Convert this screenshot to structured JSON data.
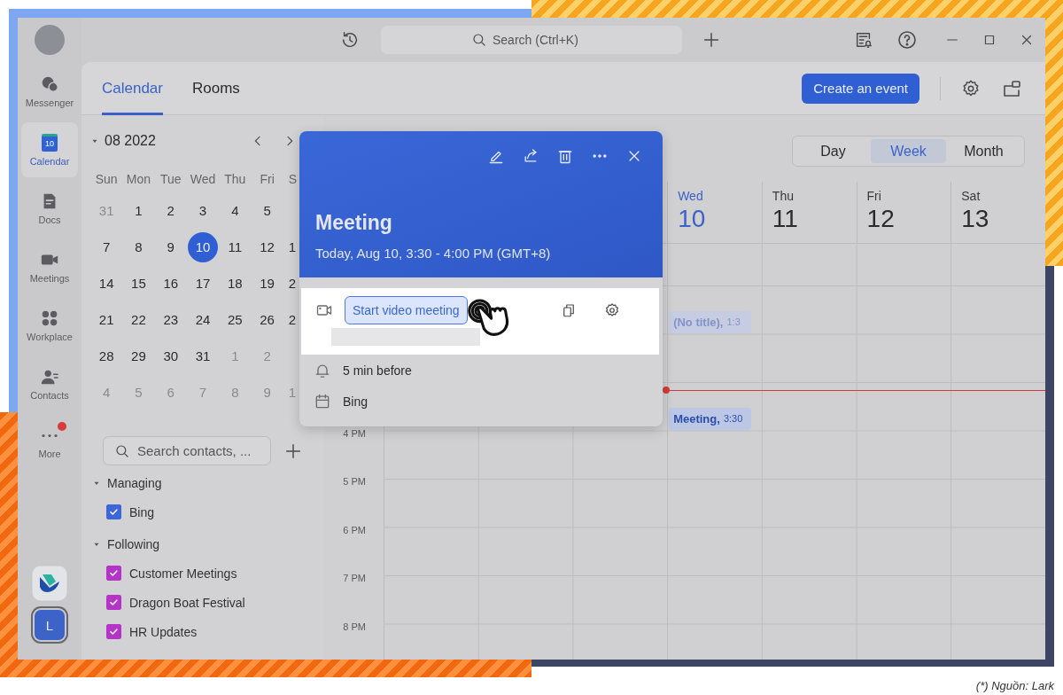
{
  "rail": {
    "items": [
      {
        "kind": "chat",
        "label": "Messenger",
        "selected": false
      },
      {
        "kind": "calendar",
        "label": "Calendar",
        "icon_text": "10",
        "selected": true
      },
      {
        "kind": "docs",
        "label": "Docs",
        "selected": false
      },
      {
        "kind": "video",
        "label": "Meetings",
        "selected": false
      },
      {
        "kind": "apps",
        "label": "Workplace",
        "selected": false
      },
      {
        "kind": "contacts",
        "label": "Contacts",
        "selected": false
      },
      {
        "kind": "more",
        "label": "More",
        "selected": false,
        "badge": true
      }
    ],
    "workspace_initial": "L"
  },
  "top_bar": {
    "search": {
      "placeholder": "Search (Ctrl+K)"
    }
  },
  "tabs": [
    {
      "label": "Calendar",
      "selected": true
    },
    {
      "label": "Rooms",
      "selected": false
    }
  ],
  "create_button": "Create an event",
  "mini_calendar": {
    "month": "08 2022",
    "weekdays": [
      "Sun",
      "Mon",
      "Tue",
      "Wed",
      "Thu",
      "Fri",
      "S"
    ],
    "weeks": [
      [
        {
          "day": "31",
          "muted": true,
          "selected": false
        },
        {
          "day": "1",
          "muted": false,
          "selected": false
        },
        {
          "day": "2",
          "muted": false,
          "selected": false
        },
        {
          "day": "3",
          "muted": false,
          "selected": false
        },
        {
          "day": "4",
          "muted": false,
          "selected": false
        },
        {
          "day": "5",
          "muted": false,
          "selected": false
        }
      ],
      [
        {
          "day": "7",
          "muted": false,
          "selected": false
        },
        {
          "day": "8",
          "muted": false,
          "selected": false
        },
        {
          "day": "9",
          "muted": false,
          "selected": false
        },
        {
          "day": "10",
          "muted": false,
          "selected": true
        },
        {
          "day": "11",
          "muted": false,
          "selected": false
        },
        {
          "day": "12",
          "muted": false,
          "selected": false
        },
        {
          "day": "1",
          "muted": false,
          "selected": false
        }
      ],
      [
        {
          "day": "14",
          "muted": false,
          "selected": false
        },
        {
          "day": "15",
          "muted": false,
          "selected": false
        },
        {
          "day": "16",
          "muted": false,
          "selected": false
        },
        {
          "day": "17",
          "muted": false,
          "selected": false
        },
        {
          "day": "18",
          "muted": false,
          "selected": false
        },
        {
          "day": "19",
          "muted": false,
          "selected": false
        },
        {
          "day": "2",
          "muted": false,
          "selected": false
        }
      ],
      [
        {
          "day": "21",
          "muted": false,
          "selected": false
        },
        {
          "day": "22",
          "muted": false,
          "selected": false
        },
        {
          "day": "23",
          "muted": false,
          "selected": false
        },
        {
          "day": "24",
          "muted": false,
          "selected": false
        },
        {
          "day": "25",
          "muted": false,
          "selected": false
        },
        {
          "day": "26",
          "muted": false,
          "selected": false
        },
        {
          "day": "2",
          "muted": false,
          "selected": false
        }
      ],
      [
        {
          "day": "28",
          "muted": false,
          "selected": false
        },
        {
          "day": "29",
          "muted": false,
          "selected": false
        },
        {
          "day": "30",
          "muted": false,
          "selected": false
        },
        {
          "day": "31",
          "muted": false,
          "selected": false
        },
        {
          "day": "1",
          "muted": true,
          "selected": false
        },
        {
          "day": "2",
          "muted": true,
          "selected": false
        }
      ],
      [
        {
          "day": "4",
          "muted": true,
          "selected": false
        },
        {
          "day": "5",
          "muted": true,
          "selected": false
        },
        {
          "day": "6",
          "muted": true,
          "selected": false
        },
        {
          "day": "7",
          "muted": true,
          "selected": false
        },
        {
          "day": "8",
          "muted": true,
          "selected": false
        },
        {
          "day": "9",
          "muted": true,
          "selected": false
        },
        {
          "day": "1",
          "muted": true,
          "selected": false
        }
      ]
    ]
  },
  "contact_search": {
    "placeholder": "Search contacts, ..."
  },
  "calendar_groups": [
    {
      "title": "Managing",
      "expanded": true,
      "items": [
        {
          "label": "Bing",
          "checked": true,
          "color": "#3e66d8"
        }
      ]
    },
    {
      "title": "Following",
      "expanded": true,
      "items": [
        {
          "label": "Customer Meetings",
          "checked": true,
          "color": "#b534c8"
        },
        {
          "label": "Dragon Boat Festival",
          "checked": true,
          "color": "#b534c8"
        },
        {
          "label": "HR Updates",
          "checked": true,
          "color": "#b534c8"
        }
      ]
    }
  ],
  "view_switch": [
    {
      "label": "Day",
      "selected": false
    },
    {
      "label": "Week",
      "selected": true
    },
    {
      "label": "Month",
      "selected": false
    }
  ],
  "week": {
    "days": [
      {
        "weekday": "Wed",
        "date": "10",
        "today": true,
        "events": [
          {
            "kind": "tentative",
            "title": "(No title),",
            "time": "1:3"
          },
          {
            "kind": "confirmed",
            "title": "Meeting,",
            "time": "3:30"
          }
        ]
      },
      {
        "weekday": "Thu",
        "date": "11",
        "today": false
      },
      {
        "weekday": "Fri",
        "date": "12",
        "today": false
      },
      {
        "weekday": "Sat",
        "date": "13",
        "today": false
      }
    ],
    "time_labels": [
      "4 PM",
      "5 PM",
      "6 PM",
      "7 PM",
      "8 PM"
    ]
  },
  "event_popup": {
    "title": "Meeting",
    "when": "Today, Aug 10, 3:30 - 4:00 PM (GMT+8)",
    "video_button": "Start video meeting",
    "reminder": "5 min before",
    "calendar": "Bing"
  },
  "caption": "(*) Nguồn: Lark"
}
